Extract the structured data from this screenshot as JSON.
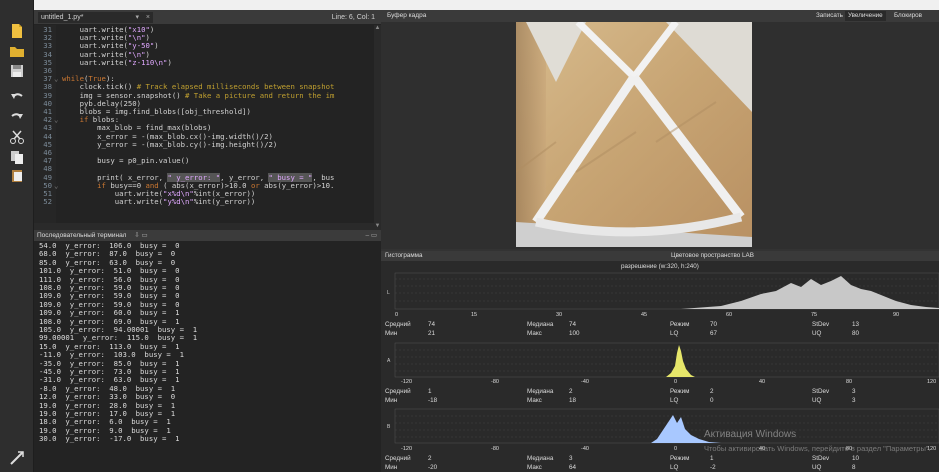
{
  "editor": {
    "tab_label": "untitled_1.py*",
    "tab_close": "×",
    "tab_dropdown": "▾",
    "cursor_pos": "Line: 6, Col: 1",
    "lines": [
      {
        "n": "31",
        "fold": "",
        "segs": [
          {
            "t": "    uart.write(",
            "c": "ct"
          },
          {
            "t": "\"x10\"",
            "c": "str"
          },
          {
            "t": ")",
            "c": "ct"
          }
        ]
      },
      {
        "n": "32",
        "fold": "",
        "segs": [
          {
            "t": "    uart.write(",
            "c": "ct"
          },
          {
            "t": "\"\\n\"",
            "c": "str"
          },
          {
            "t": ")",
            "c": "ct"
          }
        ]
      },
      {
        "n": "33",
        "fold": "",
        "segs": [
          {
            "t": "    uart.write(",
            "c": "ct"
          },
          {
            "t": "\"y-50\"",
            "c": "str"
          },
          {
            "t": ")",
            "c": "ct"
          }
        ]
      },
      {
        "n": "34",
        "fold": "",
        "segs": [
          {
            "t": "    uart.write(",
            "c": "ct"
          },
          {
            "t": "\"\\n\"",
            "c": "str"
          },
          {
            "t": ")",
            "c": "ct"
          }
        ]
      },
      {
        "n": "35",
        "fold": "",
        "segs": [
          {
            "t": "    uart.write(",
            "c": "ct"
          },
          {
            "t": "\"z-110\\n\"",
            "c": "str"
          },
          {
            "t": ")",
            "c": "ct"
          }
        ]
      },
      {
        "n": "36",
        "fold": "",
        "segs": []
      },
      {
        "n": "37",
        "fold": "⌄",
        "segs": [
          {
            "t": "while",
            "c": "kw"
          },
          {
            "t": "(",
            "c": "ct"
          },
          {
            "t": "True",
            "c": "kw"
          },
          {
            "t": "):",
            "c": "ct"
          }
        ]
      },
      {
        "n": "38",
        "fold": "",
        "segs": [
          {
            "t": "    clock.tick() ",
            "c": "ct"
          },
          {
            "t": "# Track elapsed milliseconds between snapshot",
            "c": "cm"
          }
        ]
      },
      {
        "n": "39",
        "fold": "",
        "segs": [
          {
            "t": "    img = sensor.snapshot() ",
            "c": "ct"
          },
          {
            "t": "# Take a picture and return the im",
            "c": "cm"
          }
        ]
      },
      {
        "n": "40",
        "fold": "",
        "segs": [
          {
            "t": "    pyb.delay(250)",
            "c": "ct"
          }
        ]
      },
      {
        "n": "41",
        "fold": "",
        "segs": [
          {
            "t": "    blobs = img.find_blobs([obj_threshold])",
            "c": "ct"
          }
        ]
      },
      {
        "n": "42",
        "fold": "⌄",
        "segs": [
          {
            "t": "    ",
            "c": "ct"
          },
          {
            "t": "if",
            "c": "kw"
          },
          {
            "t": " blobs:",
            "c": "ct"
          }
        ]
      },
      {
        "n": "43",
        "fold": "",
        "segs": [
          {
            "t": "        max_blob = find_max(blobs)",
            "c": "ct"
          }
        ]
      },
      {
        "n": "44",
        "fold": "",
        "segs": [
          {
            "t": "        x_error = -(max_blob.cx()-img.width()/2)",
            "c": "ct"
          }
        ]
      },
      {
        "n": "45",
        "fold": "",
        "segs": [
          {
            "t": "        y_error = -(max_blob.cy()-img.height()/2)",
            "c": "ct"
          }
        ]
      },
      {
        "n": "46",
        "fold": "",
        "segs": []
      },
      {
        "n": "47",
        "fold": "",
        "segs": [
          {
            "t": "        busy = p0_pin.value()",
            "c": "ct"
          }
        ]
      },
      {
        "n": "48",
        "fold": "",
        "segs": []
      },
      {
        "n": "49",
        "fold": "",
        "segs": [
          {
            "t": "        print( x_error, ",
            "c": "ct"
          },
          {
            "t": "\" y_error: \"",
            "c": "hl"
          },
          {
            "t": ", y_error, ",
            "c": "ct"
          },
          {
            "t": "\" busy = \"",
            "c": "hl"
          },
          {
            "t": ", bus",
            "c": "ct"
          }
        ]
      },
      {
        "n": "50",
        "fold": "⌄",
        "segs": [
          {
            "t": "        ",
            "c": "ct"
          },
          {
            "t": "if",
            "c": "kw"
          },
          {
            "t": " busy==0 ",
            "c": "ct"
          },
          {
            "t": "and",
            "c": "kw"
          },
          {
            "t": " ( abs(x_error)>10.0 ",
            "c": "ct"
          },
          {
            "t": "or",
            "c": "kw"
          },
          {
            "t": " abs(y_error)>10.",
            "c": "ct"
          }
        ]
      },
      {
        "n": "51",
        "fold": "",
        "segs": [
          {
            "t": "            uart.write(",
            "c": "ct"
          },
          {
            "t": "\"x%d\\n\"",
            "c": "str"
          },
          {
            "t": "%int(x_error))",
            "c": "ct"
          }
        ]
      },
      {
        "n": "52",
        "fold": "",
        "segs": [
          {
            "t": "            uart.write(",
            "c": "ct"
          },
          {
            "t": "\"y%d\\n\"",
            "c": "str"
          },
          {
            "t": "%int(y_error))",
            "c": "ct"
          }
        ]
      }
    ]
  },
  "terminal": {
    "title": "Последовательный терминал",
    "lines": [
      "54.0  y_error:  106.0  busy =  0",
      "68.0  y_error:  87.0  busy =  0",
      "85.0  y_error:  63.0  busy =  0",
      "101.0  y_error:  51.0  busy =  0",
      "111.0  y_error:  56.0  busy =  0",
      "108.0  y_error:  59.0  busy =  0",
      "109.0  y_error:  59.0  busy =  0",
      "109.0  y_error:  59.0  busy =  0",
      "109.0  y_error:  60.0  busy =  1",
      "108.0  y_error:  69.0  busy =  1",
      "105.0  y_error:  94.00001  busy =  1",
      "99.00001  y_error:  115.0  busy =  1",
      "15.0  y_error:  113.0  busy =  1",
      "-11.0  y_error:  103.0  busy =  1",
      "-35.0  y_error:  85.0  busy =  1",
      "-45.0  y_error:  73.0  busy =  1",
      "-31.0  y_error:  63.0  busy =  1",
      "-8.0  y_error:  48.0  busy =  1",
      "12.0  y_error:  33.0  busy =  0",
      "19.0  y_error:  28.0  busy =  1",
      "19.0  y_error:  17.0  busy =  1",
      "18.0  y_error:  6.0  busy =  1",
      "19.0  y_error:  9.0  busy =  1",
      "30.0  y_error:  -17.0  busy =  1"
    ]
  },
  "framebuffer": {
    "title": "Буфер кадра",
    "btn_record": "Записать",
    "btn_zoom": "Увеличение",
    "btn_lock": "Блокиров"
  },
  "histogram": {
    "title": "Гистограмма",
    "colorspace": "Цветовое пространство LAB",
    "resolution": "разрешение (w:320, h:240)",
    "l_ticks": [
      "0",
      "15",
      "30",
      "45",
      "60",
      "75",
      "90"
    ],
    "ab_ticks": [
      "-120",
      "-80",
      "-40",
      "0",
      "40",
      "80",
      "120"
    ],
    "labels": {
      "mean": "Средний",
      "median": "Медиана",
      "mode": "Режим",
      "stdev": "StDev",
      "min": "Мин",
      "max": "Макс",
      "lq": "LQ",
      "uq": "UQ"
    },
    "l_stats": {
      "mean": "74",
      "median": "74",
      "mode": "70",
      "stdev": "13",
      "min": "21",
      "max": "100",
      "lq": "67",
      "uq": "80"
    },
    "a_stats": {
      "mean": "1",
      "median": "2",
      "mode": "2",
      "stdev": "3",
      "min": "-18",
      "max": "18",
      "lq": "0",
      "uq": "3"
    },
    "b_stats": {
      "mean": "2",
      "median": "3",
      "mode": "1",
      "stdev": "10",
      "min": "-20",
      "max": "64",
      "lq": "-2",
      "uq": "8"
    },
    "l_color": "#c8c8c8",
    "a_color": "#e6e66a",
    "b_color": "#a8c8ff"
  },
  "watermark": {
    "title": "Активация Windows",
    "subtitle": "Чтобы активировать Windows, перейдите в раздел \"Параметры\"."
  }
}
